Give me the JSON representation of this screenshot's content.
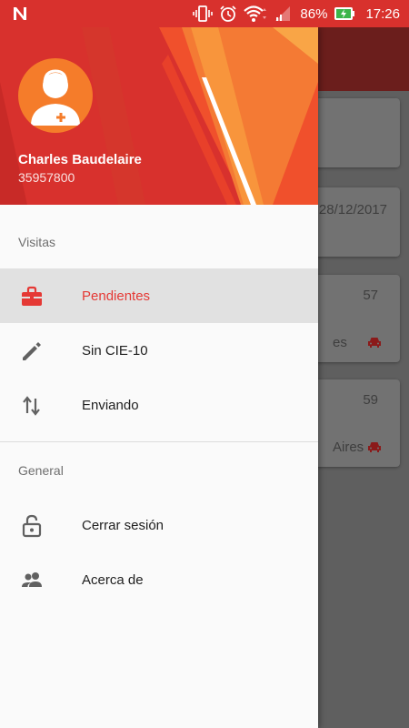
{
  "status_bar": {
    "battery": "86%",
    "time": "17:26"
  },
  "background": {
    "cards": [
      {
        "date": "28/12/2017"
      },
      {
        "number": "57",
        "place_fragment": "es"
      },
      {
        "number": "59",
        "place_fragment": "Aires"
      }
    ]
  },
  "drawer": {
    "user": {
      "name": "Charles Baudelaire",
      "id": "35957800"
    },
    "sections": [
      {
        "title": "Visitas",
        "items": [
          {
            "label": "Pendientes",
            "icon": "briefcase-icon",
            "active": true
          },
          {
            "label": "Sin CIE-10",
            "icon": "pencil-icon",
            "active": false
          },
          {
            "label": "Enviando",
            "icon": "swap-vertical-icon",
            "active": false
          }
        ]
      },
      {
        "title": "General",
        "items": [
          {
            "label": "Cerrar sesión",
            "icon": "lock-open-icon",
            "active": false
          },
          {
            "label": "Acerca de",
            "icon": "people-icon",
            "active": false
          }
        ]
      }
    ]
  },
  "colors": {
    "primary": "#d8312d",
    "active_text": "#e53935",
    "avatar": "#f57c2a"
  }
}
